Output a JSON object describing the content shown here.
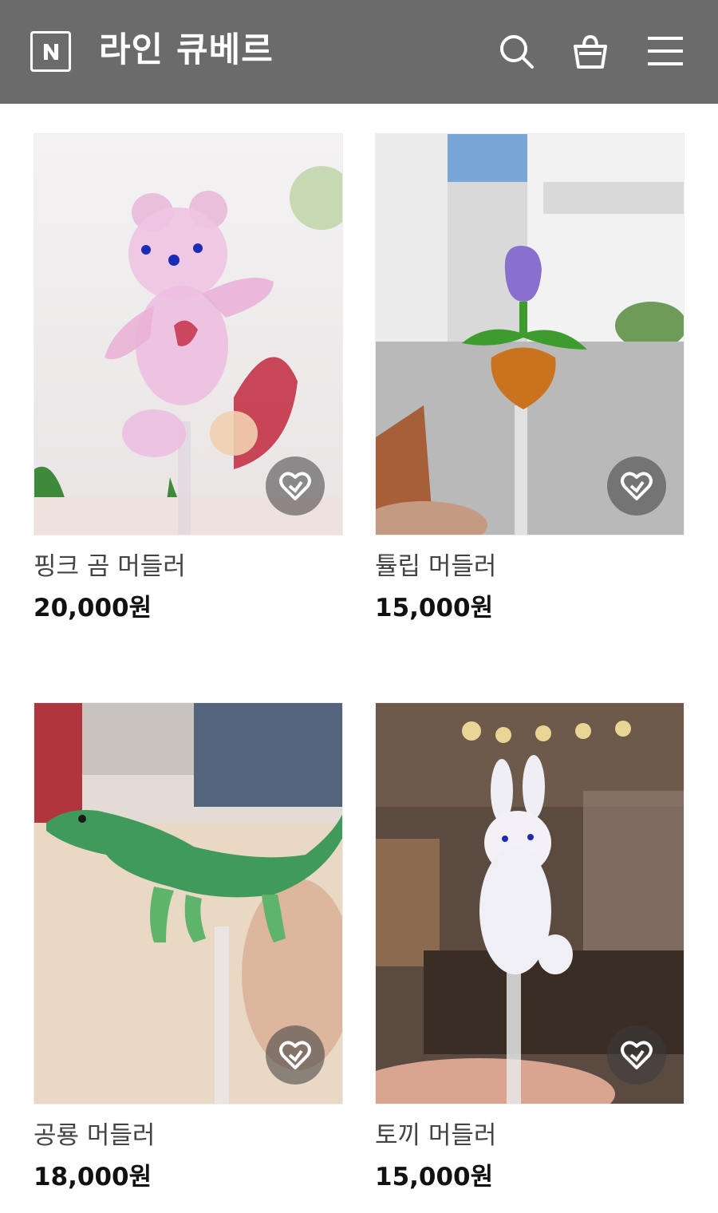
{
  "header": {
    "logo_icon": "naver-n-icon",
    "title": "라인 큐베르",
    "icons": [
      "search-icon",
      "shopping-bag-icon",
      "hamburger-menu-icon"
    ],
    "background": "#6b6b6b"
  },
  "products": [
    {
      "name": "핑크 곰 머들러",
      "price": "20,000원",
      "image": "pink-bear-glass-muddler"
    },
    {
      "name": "튤립 머들러",
      "price": "15,000원",
      "image": "tulip-glass-muddler"
    },
    {
      "name": "공룡 머들러",
      "price": "18,000원",
      "image": "dinosaur-glass-muddler"
    },
    {
      "name": "토끼 머들러",
      "price": "15,000원",
      "image": "rabbit-glass-muddler"
    }
  ],
  "wish_icon": "heart-wishlist-icon"
}
